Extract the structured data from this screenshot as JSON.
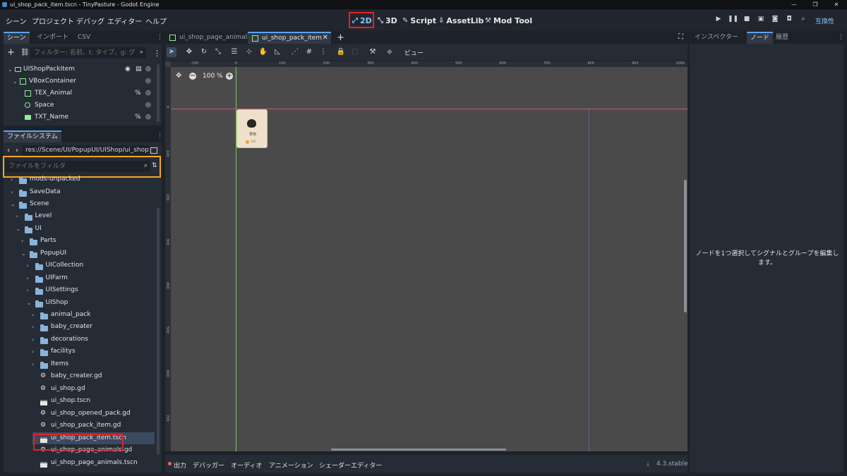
{
  "window": {
    "title": "ui_shop_pack_item.tscn - TinyPasture - Godot Engine"
  },
  "menus": [
    "シーン",
    "プロジェクト",
    "デバッグ",
    "エディター",
    "ヘルプ"
  ],
  "workspaces": [
    {
      "label": "2D",
      "active": true
    },
    {
      "label": "3D",
      "active": false
    },
    {
      "label": "Script",
      "active": false
    },
    {
      "label": "AssetLib",
      "active": false
    },
    {
      "label": "Mod Tool",
      "active": false
    }
  ],
  "renderer": "互換性",
  "scene_dock": {
    "tabs": [
      "シーン",
      "インポート",
      "CSV"
    ],
    "filter_placeholder": "フィルター: 名前、t: タイプ、g: グ",
    "nodes": [
      {
        "name": "UIShopPackItem"
      },
      {
        "name": "VBoxContainer"
      },
      {
        "name": "TEX_Animal"
      },
      {
        "name": "Space"
      },
      {
        "name": "TXT_Name"
      }
    ]
  },
  "filesystem_dock": {
    "title": "ファイルシステム",
    "path": "res://Scene/UI/PopupUI/UIShop/ui_shop",
    "filter_placeholder": "ファイルをフィルタ",
    "items": [
      {
        "name": "mods-unpacked",
        "type": "folder"
      },
      {
        "name": "SaveData",
        "type": "folder"
      },
      {
        "name": "Scene",
        "type": "folder"
      },
      {
        "name": "Level",
        "type": "folder"
      },
      {
        "name": "UI",
        "type": "folder"
      },
      {
        "name": "Parts",
        "type": "folder"
      },
      {
        "name": "PopupUI",
        "type": "folder"
      },
      {
        "name": "UICollection",
        "type": "folder"
      },
      {
        "name": "UIFarm",
        "type": "folder"
      },
      {
        "name": "UISettings",
        "type": "folder"
      },
      {
        "name": "UIShop",
        "type": "folder"
      },
      {
        "name": "animal_pack",
        "type": "folder"
      },
      {
        "name": "baby_creater",
        "type": "folder"
      },
      {
        "name": "decorations",
        "type": "folder"
      },
      {
        "name": "facilitys",
        "type": "folder"
      },
      {
        "name": "Items",
        "type": "folder"
      },
      {
        "name": "baby_creater.gd",
        "type": "script"
      },
      {
        "name": "ui_shop.gd",
        "type": "script"
      },
      {
        "name": "ui_shop.tscn",
        "type": "scene"
      },
      {
        "name": "ui_shop_opened_pack.gd",
        "type": "script"
      },
      {
        "name": "ui_shop_pack_item.gd",
        "type": "script"
      },
      {
        "name": "ui_shop_pack_item.tscn",
        "type": "scene"
      },
      {
        "name": "ui_shop_page_animals.gd",
        "type": "script"
      },
      {
        "name": "ui_shop_page_animals.tscn",
        "type": "scene"
      }
    ]
  },
  "editor_tabs": [
    {
      "label": "ui_shop_page_animals",
      "active": false
    },
    {
      "label": "ui_shop_pack_item",
      "active": true
    }
  ],
  "viewport": {
    "zoom": "100 %",
    "view_menu": "ビュー",
    "ruler_labels": [
      "-100",
      "0",
      "100",
      "200",
      "300",
      "400",
      "500",
      "600",
      "700",
      "800",
      "900",
      "1000"
    ],
    "ruler_left_labels": [
      "0",
      "100",
      "200",
      "300",
      "400",
      "500",
      "600",
      "700"
    ],
    "card": {
      "name": "果物",
      "price": "100"
    }
  },
  "right_dock": {
    "tabs": [
      "インスペクター",
      "ノード",
      "履歴"
    ],
    "message": "ノードを1つ選択してシグナルとグループを編集します。"
  },
  "bottom_panel": {
    "tabs": [
      "出力",
      "デバッガー",
      "オーディオ",
      "アニメーション",
      "シェーダーエディター"
    ],
    "version": "4.3.stable"
  },
  "colors": {
    "accent": "#5aa5ff",
    "highlight_red": "#e8202a",
    "highlight_orange": "#f5a623"
  }
}
